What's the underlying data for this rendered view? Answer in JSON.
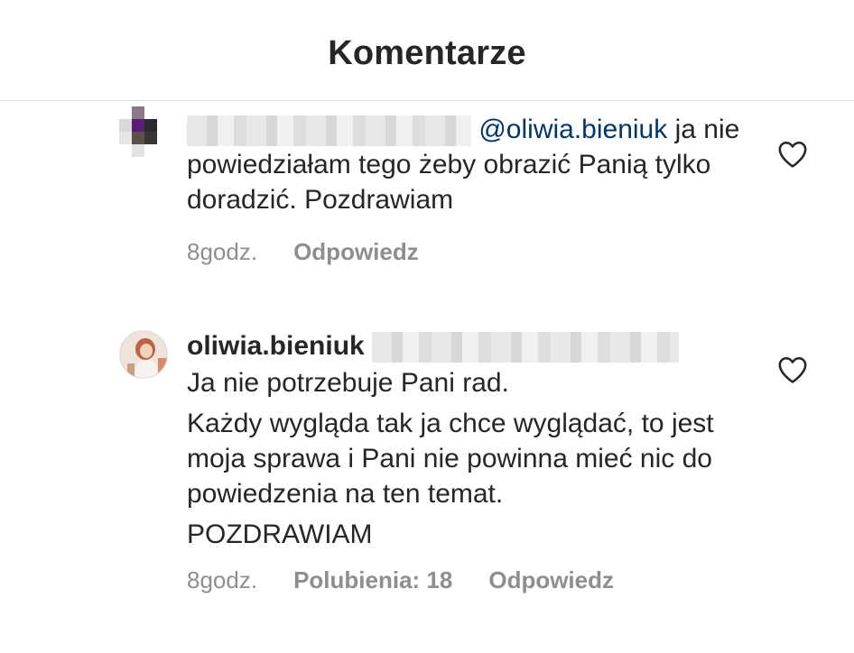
{
  "header": {
    "title": "Komentarze"
  },
  "comments": [
    {
      "username": "",
      "mention": "@oliwia.bieniuk",
      "text_line1_end": " ja",
      "text_rest": "nie powiedziałam tego żeby obrazić Panią tylko doradzić. Pozdrawiam",
      "time": "8godz.",
      "reply_label": "Odpowiedz"
    },
    {
      "username": "oliwia.bieniuk",
      "paragraphs": [
        "Ja nie potrzebuje Pani rad.",
        "Każdy wygląda tak ja chce wyglądać, to jest moja sprawa i Pani nie powinna mieć nic do powiedzenia na ten temat.",
        "POZDRAWIAM"
      ],
      "time": "8godz.",
      "likes_label": "Polubienia: 18",
      "reply_label": "Odpowiedz"
    }
  ],
  "icons": {
    "like": "heart-outline-icon"
  },
  "colors": {
    "text": "#262626",
    "meta": "#8e8e8e",
    "mention": "#00376b",
    "divider": "#dbdbdb"
  }
}
